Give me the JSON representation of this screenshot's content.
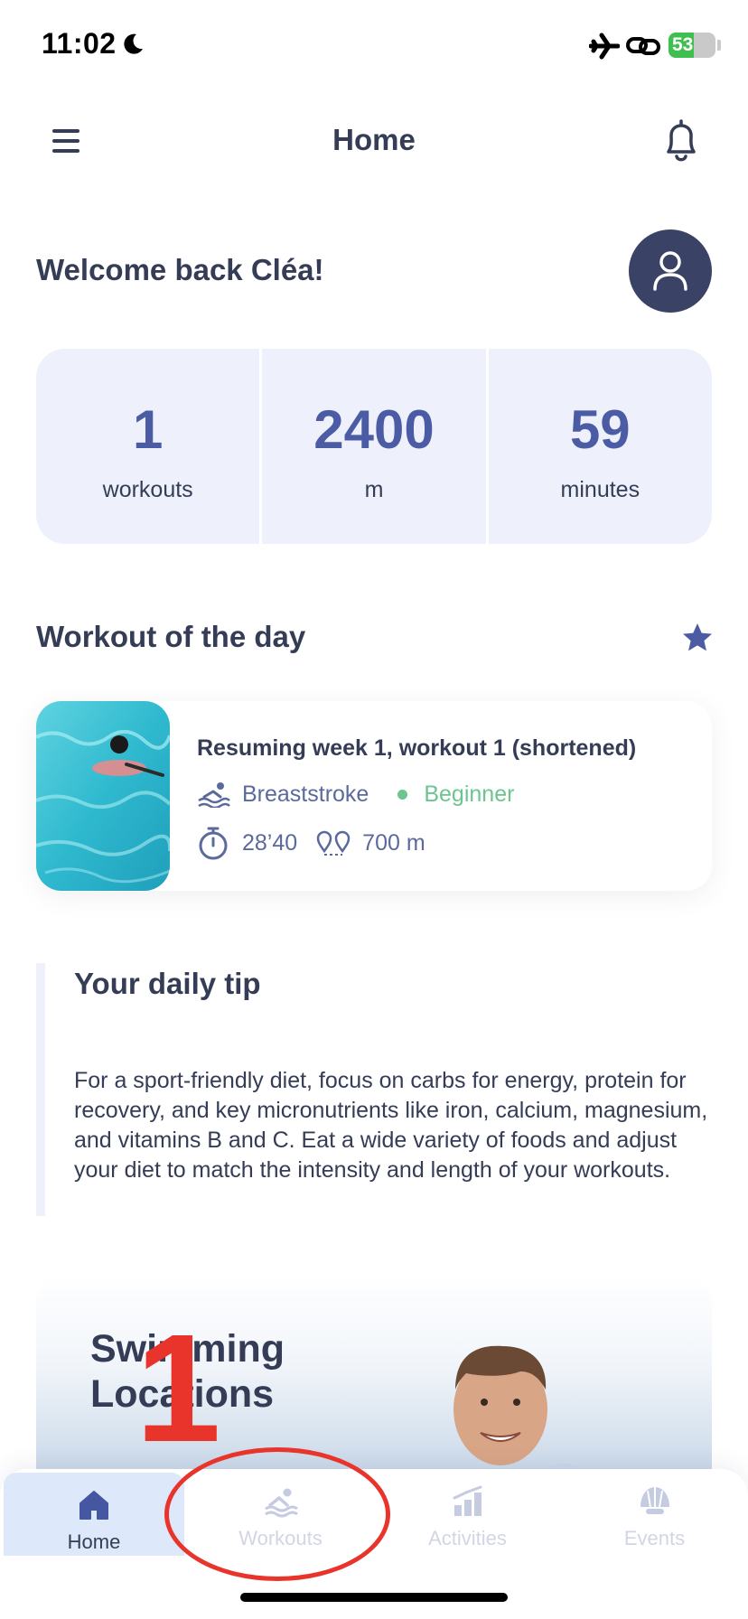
{
  "status_bar": {
    "time": "11:02",
    "battery": "53"
  },
  "header": {
    "title": "Home"
  },
  "welcome": "Welcome back Cléa!",
  "stats": [
    {
      "value": "1",
      "label": "workouts"
    },
    {
      "value": "2400",
      "label": "m"
    },
    {
      "value": "59",
      "label": "minutes"
    }
  ],
  "workout_of_day": {
    "section_title": "Workout of the day",
    "name": "Resuming week 1, workout 1 (shortened)",
    "stroke": "Breaststroke",
    "level": "Beginner",
    "duration": "28’40",
    "distance": "700 m"
  },
  "tip": {
    "title": "Your daily tip",
    "body": "For a sport-friendly diet, focus on carbs for energy, protein for recovery, and key micronutrients like iron, calcium, magnesium, and vitamins B and C. Eat a wide variety of foods and adjust your diet to match the intensity and length of your workouts."
  },
  "locations": {
    "title": "Swimming Locations"
  },
  "annotation": {
    "step": "1"
  },
  "nav": {
    "items": [
      {
        "label": "Home",
        "icon": "house-icon",
        "active": true
      },
      {
        "label": "Workouts",
        "icon": "swimmer-icon"
      },
      {
        "label": "Activities",
        "icon": "bar-chart-icon"
      },
      {
        "label": "Events",
        "icon": "shell-icon"
      }
    ]
  },
  "colors": {
    "accent": "#4b5ca5",
    "stat_bg": "#eef1fc",
    "beginner": "#6cc491",
    "annotation": "#e8342a"
  }
}
